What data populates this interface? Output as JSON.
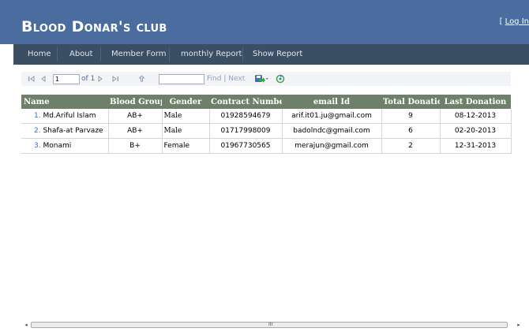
{
  "header": {
    "title": "Blood Donar's club",
    "login_prefix": "[ ",
    "login_label": "Log In",
    "bg_color": "#4b6c9e"
  },
  "nav": {
    "items": [
      "Home",
      "About",
      "Member Form",
      "monthly Report",
      "Show Report"
    ],
    "bg_color": "#3a4f63"
  },
  "toolbar": {
    "first_icon": "first-page-icon",
    "prev_icon": "previous-page-icon",
    "page_value": "1",
    "of_text": "of 1",
    "next_icon": "next-page-icon",
    "last_icon": "last-page-icon",
    "back_icon": "back-icon",
    "search_value": "",
    "find_label": "Find",
    "find_sep": "|",
    "next_label": "Next",
    "export_icon": "export-save-icon",
    "refresh_icon": "refresh-icon"
  },
  "table": {
    "header_color": "#6e7f6a",
    "columns": [
      "Name",
      "Blood Group",
      "Gender",
      "Contract Number",
      "email Id",
      "Total Donation",
      "Last Donation"
    ],
    "rows": [
      {
        "num": "1.",
        "name": "Md.Ariful Islam",
        "blood_group": "AB+",
        "gender": "Male",
        "contact": "01928594679",
        "email": "arif.it01.ju@gmail.com",
        "total": "9",
        "last": "08-12-2013"
      },
      {
        "num": "2.",
        "name": "Shafa-at Parvaze",
        "blood_group": "AB+",
        "gender": "Male",
        "contact": "01717998009",
        "email": "badolndc@gmail.com",
        "total": "6",
        "last": "02-20-2013"
      },
      {
        "num": "3.",
        "name": "Monami",
        "blood_group": "B+",
        "gender": "Female",
        "contact": "01967730565",
        "email": "merajun@gmail.com",
        "total": "2",
        "last": "12-31-2013"
      }
    ]
  },
  "scrollbar": {
    "left_arrow": "◂",
    "grip": "III",
    "right_arrow": "▸"
  }
}
